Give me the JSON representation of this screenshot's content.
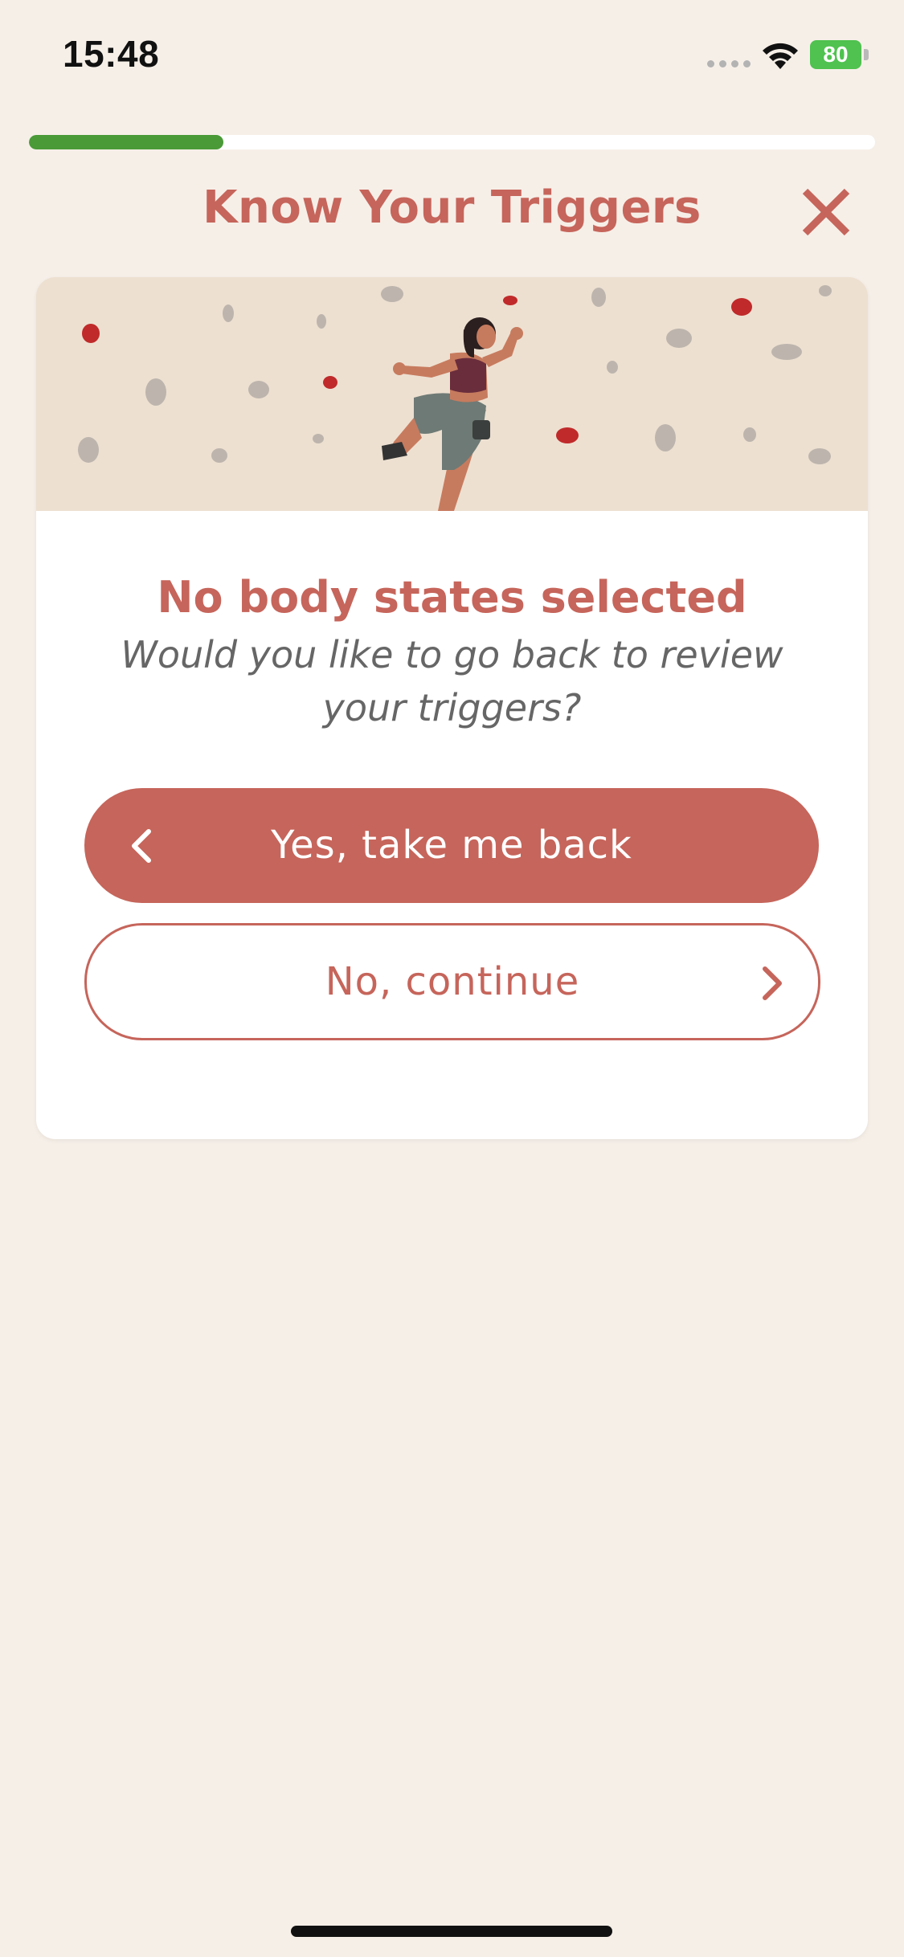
{
  "status_bar": {
    "time": "15:48",
    "battery_level": "80"
  },
  "progress": {
    "fraction": 0.23,
    "color": "#4a9a37"
  },
  "header": {
    "title": "Know Your Triggers",
    "close_icon": "close-icon"
  },
  "dialog": {
    "title": "No body states selected",
    "subtitle": "Would you like to go back to review your triggers?",
    "primary_button": "Yes, take me back",
    "secondary_button": "No, continue"
  },
  "colors": {
    "accent": "#c6655b",
    "background": "#f6efe8",
    "hero_background": "#ede0d1"
  }
}
